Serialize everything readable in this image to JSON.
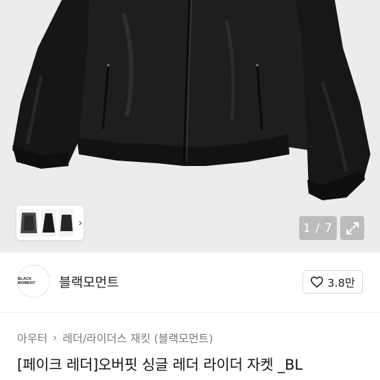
{
  "gallery": {
    "counter": "1 / 7",
    "thumb_arrow": "›"
  },
  "seller": {
    "avatar_text": "BLACK MOMENT",
    "name": "블랙모먼트",
    "likes": "3.8만"
  },
  "breadcrumb": {
    "level1": "아우터",
    "level2": "레더/라이더스 재킷 (블랙모먼트)"
  },
  "product": {
    "title": "[페이크 레더]오버핏 싱글 레더 라이더 자켓 _BL"
  },
  "icons": {
    "expand": "expand-icon",
    "heart": "heart-outline-icon",
    "chevron": "chevron-right-icon"
  },
  "colors": {
    "hero_bg": "#ececec",
    "jacket": "#1b1b1b",
    "overlay": "#969696"
  }
}
